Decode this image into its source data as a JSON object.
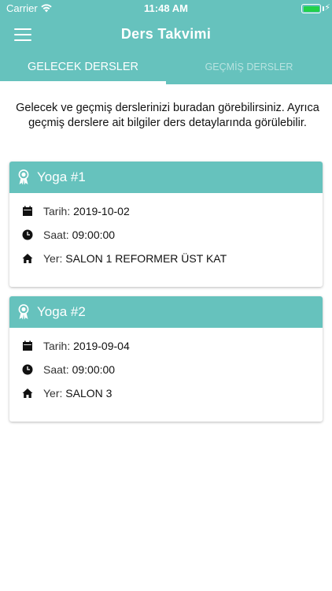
{
  "status_bar": {
    "carrier": "Carrier",
    "time": "11:48 AM",
    "battery_color": "#22d14a"
  },
  "header": {
    "title": "Ders Takvimi",
    "menu_icon": "hamburger-icon",
    "background": "#66c2bd"
  },
  "tabs": [
    {
      "label": "GELECEK DERSLER",
      "active": true
    },
    {
      "label": "GEÇMİŞ DERSLER",
      "active": false
    }
  ],
  "intro_text": "Gelecek ve geçmiş derslerinizi buradan görebilirsiniz. Ayrıca geçmiş derslere ait bilgiler ders detaylarında görülebilir.",
  "lessons": [
    {
      "title": "Yoga #1",
      "date_label": "Tarih:",
      "date": "2019-10-02",
      "time_label": "Saat:",
      "time": "09:00:00",
      "place_label": "Yer:",
      "place": "SALON 1 REFORMER ÜST KAT"
    },
    {
      "title": "Yoga #2",
      "date_label": "Tarih:",
      "date": "2019-09-04",
      "time_label": "Saat:",
      "time": "09:00:00",
      "place_label": "Yer:",
      "place": "SALON 3"
    }
  ]
}
